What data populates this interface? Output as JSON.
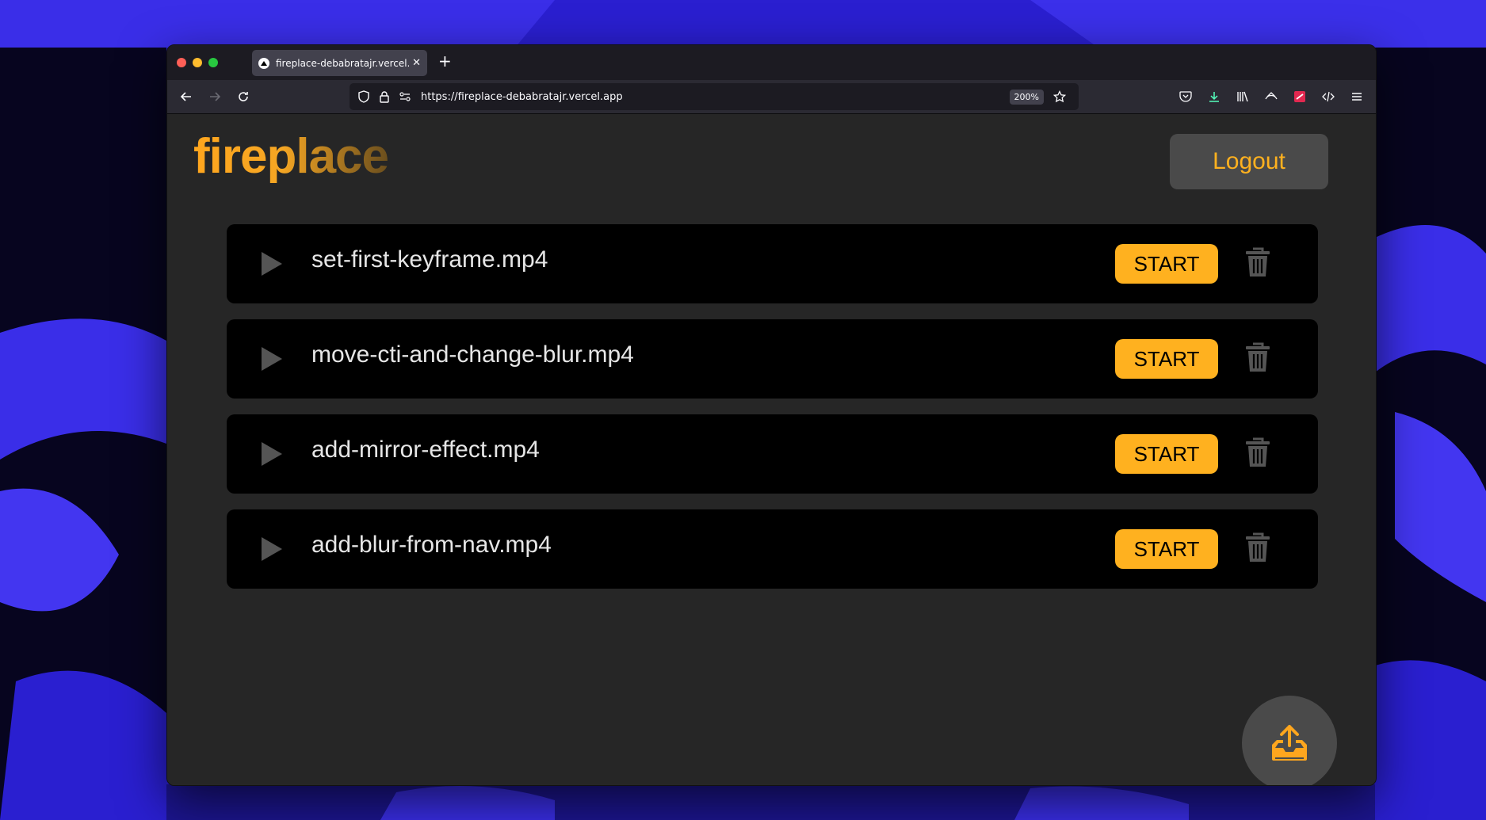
{
  "browser": {
    "tab_title": "fireplace-debabratajr.vercel.app/",
    "url": "https://fireplace-debabratajr.vercel.app",
    "zoom": "200%"
  },
  "app": {
    "logo": "fireplace",
    "logout_label": "Logout",
    "accent_color": "#ffb11f",
    "videos": [
      {
        "name": "set-first-keyframe.mp4",
        "start_label": "START"
      },
      {
        "name": "move-cti-and-change-blur.mp4",
        "start_label": "START"
      },
      {
        "name": "add-mirror-effect.mp4",
        "start_label": "START"
      },
      {
        "name": "add-blur-from-nav.mp4",
        "start_label": "START"
      }
    ],
    "icons": {
      "play": "play-icon",
      "delete": "trash-icon",
      "upload": "upload-icon"
    }
  }
}
